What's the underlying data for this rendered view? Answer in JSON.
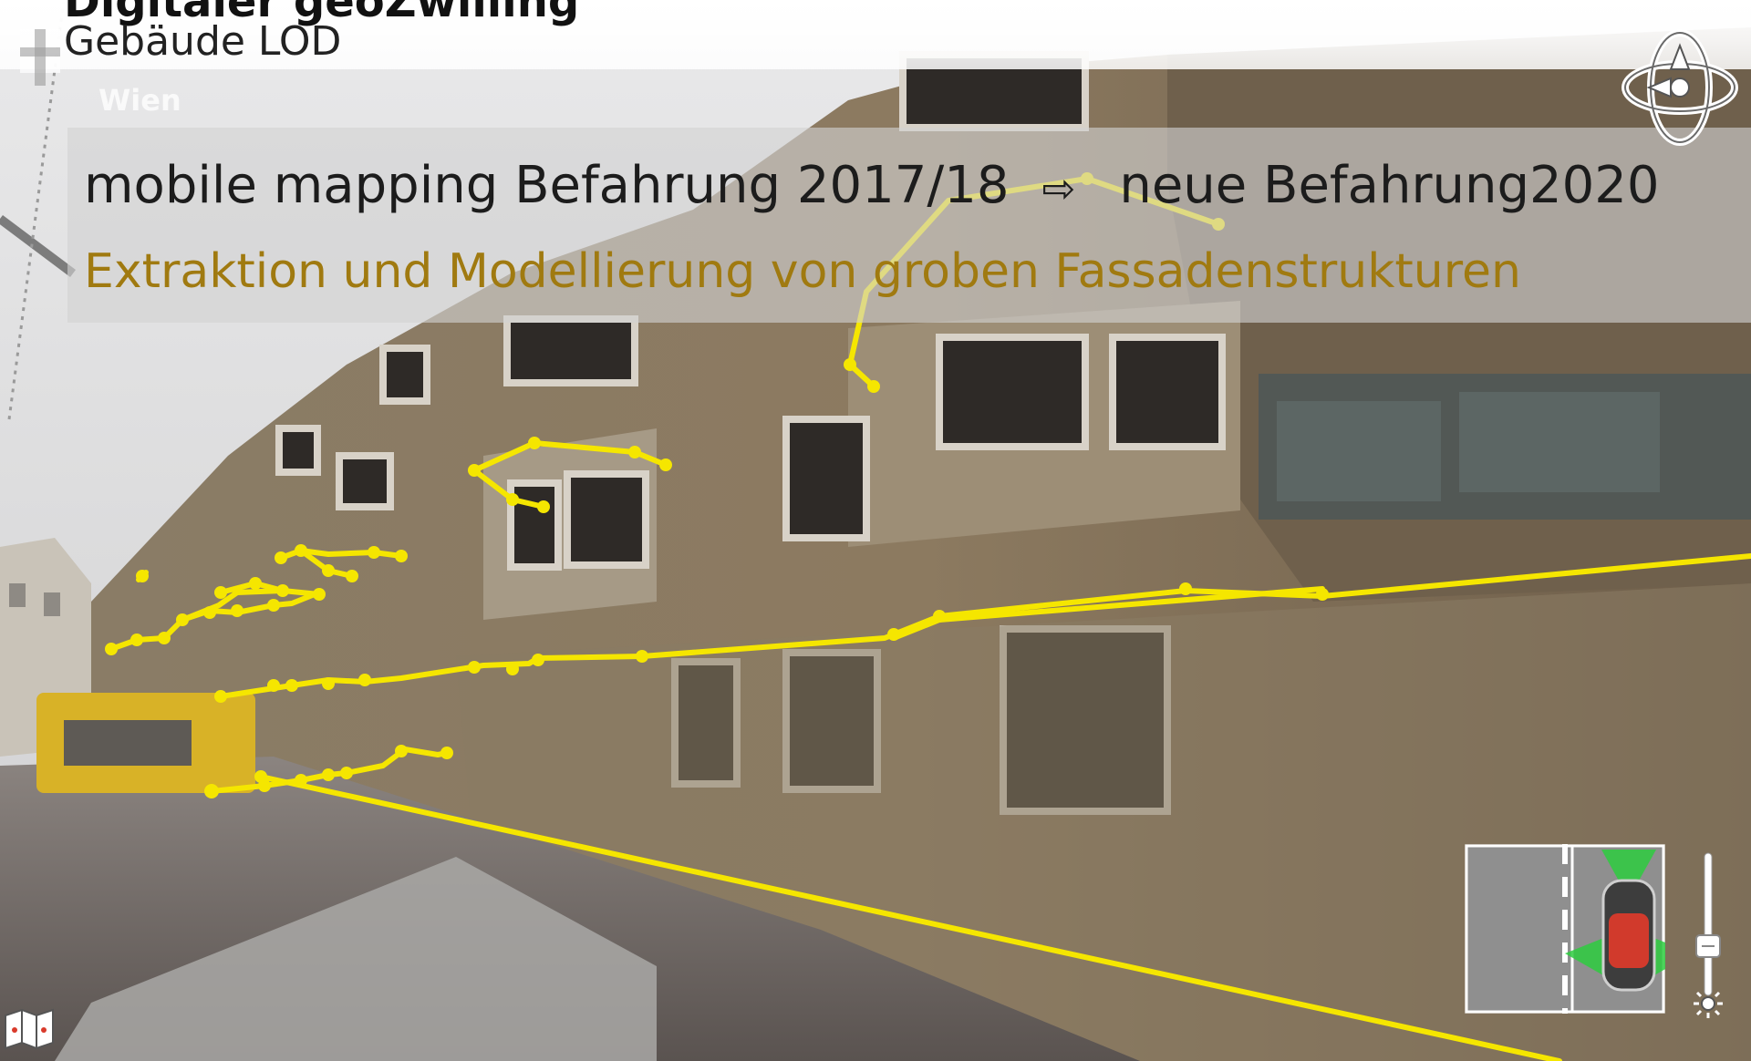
{
  "header": {
    "title": "Digitaler geoZwilling",
    "subtitle": "Gebäude LOD",
    "logo_text": "Wien"
  },
  "info": {
    "line1_left": "mobile mapping Befahrung 2017/18",
    "line1_arrow": "⇨",
    "line1_right": "neue Befahrung2020",
    "line2": "Extraktion und Modellierung von groben Fassadenstrukturen"
  },
  "colors": {
    "accent_text": "#a07a10",
    "extraction_line": "#f5e600",
    "minimap_green": "#2ecc40",
    "minimap_red": "#d93a2b"
  },
  "icons": {
    "nav": "navigation-compass-icon",
    "brightness": "brightness-icon",
    "map_toggle": "map-toggle-icon",
    "logo": "wien-logo"
  }
}
